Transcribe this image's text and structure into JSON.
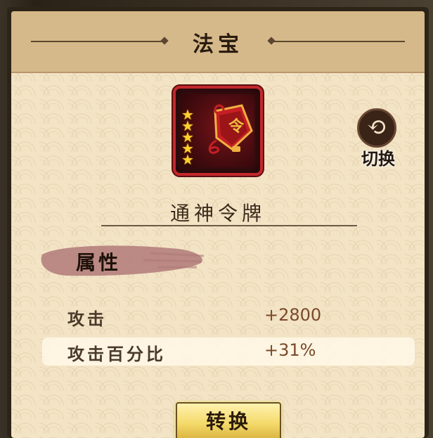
{
  "header": {
    "title": "法宝"
  },
  "item": {
    "icon": "token-icon",
    "icon_glyph": "令",
    "stars": 5,
    "name": "通神令牌"
  },
  "switch_button": {
    "icon": "swap-arrows-icon",
    "label": "切换"
  },
  "attributes": {
    "heading": "属性",
    "stats": [
      {
        "name": "攻击",
        "value": "+2800"
      },
      {
        "name": "攻击百分比",
        "value": "+31%"
      }
    ]
  },
  "convert_button": {
    "label": "转换"
  },
  "colors": {
    "panel_bg": "#f3e4c6",
    "header_bg": "#d6b98a",
    "icon_border": "#c2282b",
    "star": "#ffcf2e",
    "stat_value": "#7a4a2a",
    "button_gold": "#f4d96a"
  }
}
